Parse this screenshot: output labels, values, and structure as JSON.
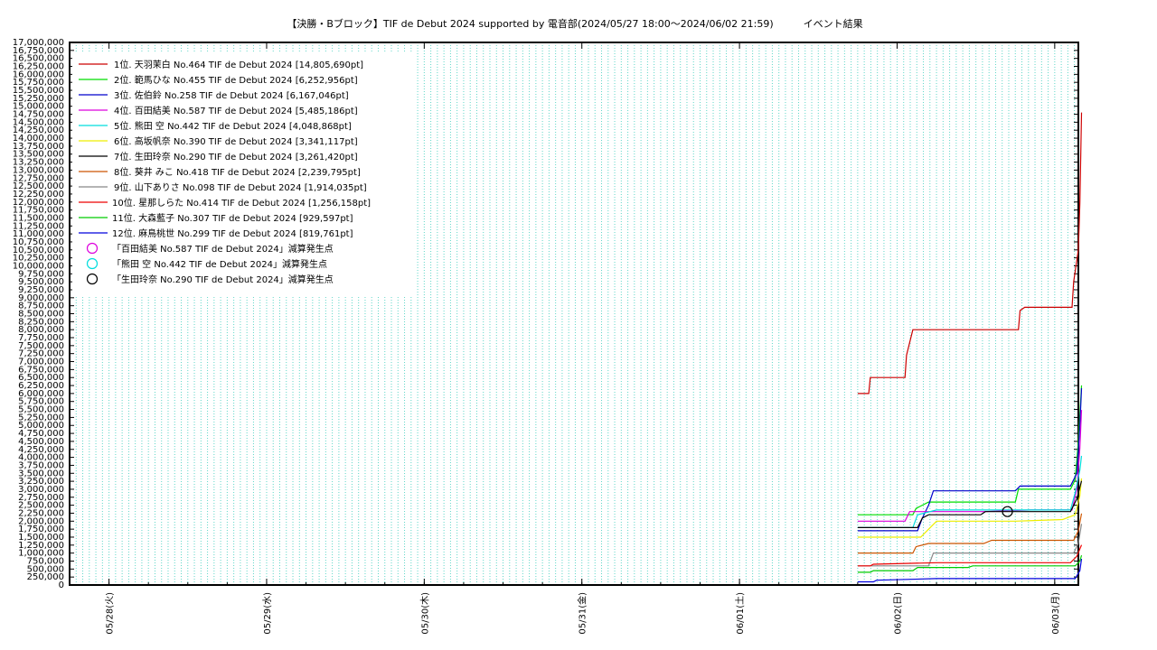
{
  "chart_data": {
    "type": "line",
    "title": "【決勝・Bブロック】TIF de Debut 2024 supported by 電音部(2024/05/27 18:00～2024/06/02 21:59)　　　イベント結果",
    "ylim": [
      0,
      17000000
    ],
    "xlim": [
      0,
      6.4
    ],
    "x_ticks": [
      {
        "x": 0.25,
        "label": "05/28(火)"
      },
      {
        "x": 1.25,
        "label": "05/29(水)"
      },
      {
        "x": 2.25,
        "label": "05/30(木)"
      },
      {
        "x": 3.25,
        "label": "05/31(金)"
      },
      {
        "x": 4.25,
        "label": "06/01(土)"
      },
      {
        "x": 5.25,
        "label": "06/02(日)"
      },
      {
        "x": 6.25,
        "label": "06/03(月)"
      }
    ],
    "y_tick_step": 250000,
    "grid": true,
    "legend_position": "top-left",
    "series": [
      {
        "name": "1位. 天羽茉白 No.464 TIF de Debut 2024 [14,805,690pt]",
        "color": "#cc0000",
        "points": [
          [
            5.0,
            6000000
          ],
          [
            5.07,
            6000000
          ],
          [
            5.08,
            6500000
          ],
          [
            5.3,
            6500000
          ],
          [
            5.31,
            7200000
          ],
          [
            5.33,
            7600000
          ],
          [
            5.35,
            8000000
          ],
          [
            6.02,
            8000000
          ],
          [
            6.03,
            8600000
          ],
          [
            6.06,
            8700000
          ],
          [
            6.36,
            8700000
          ],
          [
            6.37,
            9500000
          ],
          [
            6.4,
            10500000
          ],
          [
            6.41,
            12000000
          ],
          [
            6.42,
            14805690
          ]
        ]
      },
      {
        "name": "2位. 範馬ひな No.455 TIF de Debut 2024 [6,252,956pt]",
        "color": "#00dd00",
        "points": [
          [
            5.0,
            2200000
          ],
          [
            5.35,
            2200000
          ],
          [
            5.37,
            2400000
          ],
          [
            5.45,
            2600000
          ],
          [
            6.0,
            2600000
          ],
          [
            6.02,
            3000000
          ],
          [
            6.35,
            3000000
          ],
          [
            6.38,
            3300000
          ],
          [
            6.4,
            4500000
          ],
          [
            6.42,
            6252956
          ]
        ]
      },
      {
        "name": "3位. 佐伯鈴 No.258 TIF de Debut 2024 [6,167,046pt]",
        "color": "#0000cc",
        "points": [
          [
            5.0,
            1700000
          ],
          [
            5.38,
            1700000
          ],
          [
            5.41,
            2100000
          ],
          [
            5.45,
            2500000
          ],
          [
            5.48,
            2950000
          ],
          [
            6.0,
            2950000
          ],
          [
            6.03,
            3100000
          ],
          [
            6.35,
            3100000
          ],
          [
            6.39,
            3500000
          ],
          [
            6.41,
            5000000
          ],
          [
            6.42,
            6167046
          ]
        ]
      },
      {
        "name": "4位. 百田結美 No.587 TIF de Debut 2024 [5,485,186pt]",
        "color": "#dd00dd",
        "points": [
          [
            5.0,
            2000000
          ],
          [
            5.3,
            2000000
          ],
          [
            5.33,
            2300000
          ],
          [
            5.52,
            2300000
          ],
          [
            5.8,
            2300000
          ],
          [
            6.1,
            2350000
          ],
          [
            6.36,
            2350000
          ],
          [
            6.39,
            3000000
          ],
          [
            6.41,
            4300000
          ],
          [
            6.42,
            5485186
          ]
        ]
      },
      {
        "name": "5位. 熊田 空 No.442 TIF de Debut 2024 [4,048,868pt]",
        "color": "#00dddd",
        "points": [
          [
            5.0,
            1800000
          ],
          [
            5.35,
            1800000
          ],
          [
            5.38,
            2200000
          ],
          [
            5.5,
            2350000
          ],
          [
            6.35,
            2350000
          ],
          [
            6.38,
            2900000
          ],
          [
            6.41,
            3600000
          ],
          [
            6.42,
            4048868
          ]
        ]
      },
      {
        "name": "6位. 高坂帆奈 No.390 TIF de Debut 2024 [3,341,117pt]",
        "color": "#eeee00",
        "points": [
          [
            5.0,
            1500000
          ],
          [
            5.4,
            1500000
          ],
          [
            5.44,
            1700000
          ],
          [
            5.5,
            2000000
          ],
          [
            6.0,
            2000000
          ],
          [
            6.3,
            2050000
          ],
          [
            6.38,
            2200000
          ],
          [
            6.41,
            2800000
          ],
          [
            6.42,
            3341117
          ]
        ]
      },
      {
        "name": "7位. 生田玲奈 No.290 TIF de Debut 2024 [3,261,420pt]",
        "color": "#000000",
        "points": [
          [
            5.0,
            1800000
          ],
          [
            5.38,
            1800000
          ],
          [
            5.41,
            2100000
          ],
          [
            5.45,
            2200000
          ],
          [
            5.78,
            2200000
          ],
          [
            5.81,
            2300000
          ],
          [
            6.35,
            2300000
          ],
          [
            6.39,
            2700000
          ],
          [
            6.42,
            3261420
          ]
        ]
      },
      {
        "name": "8位. 葵井 みこ No.418 TIF de Debut 2024 [2,239,795pt]",
        "color": "#cc5500",
        "points": [
          [
            5.0,
            1000000
          ],
          [
            5.35,
            1000000
          ],
          [
            5.37,
            1200000
          ],
          [
            5.45,
            1300000
          ],
          [
            5.8,
            1300000
          ],
          [
            5.85,
            1400000
          ],
          [
            6.37,
            1400000
          ],
          [
            6.4,
            1700000
          ],
          [
            6.42,
            2239795
          ]
        ]
      },
      {
        "name": "9位. 山下ありさ No.098 TIF de Debut 2024 [1,914,035pt]",
        "color": "#888888",
        "points": [
          [
            5.0,
            600000
          ],
          [
            5.45,
            600000
          ],
          [
            5.48,
            1000000
          ],
          [
            6.37,
            1000000
          ],
          [
            6.4,
            1300000
          ],
          [
            6.42,
            1914035
          ]
        ]
      },
      {
        "name": "10位. 星那しらた No.414 TIF de Debut 2024 [1,256,158pt]",
        "color": "#ee0000",
        "points": [
          [
            5.0,
            600000
          ],
          [
            5.08,
            600000
          ],
          [
            5.1,
            650000
          ],
          [
            5.5,
            700000
          ],
          [
            6.35,
            700000
          ],
          [
            6.39,
            900000
          ],
          [
            6.42,
            1256158
          ]
        ]
      },
      {
        "name": "11位. 大森藍子 No.307 TIF de Debut 2024 [929,597pt]",
        "color": "#00cc00",
        "points": [
          [
            5.0,
            400000
          ],
          [
            5.08,
            400000
          ],
          [
            5.1,
            450000
          ],
          [
            5.35,
            450000
          ],
          [
            5.38,
            550000
          ],
          [
            5.7,
            550000
          ],
          [
            5.73,
            600000
          ],
          [
            6.38,
            600000
          ],
          [
            6.41,
            750000
          ],
          [
            6.42,
            929597
          ]
        ]
      },
      {
        "name": "12位. 麻鳥桃世 No.299 TIF de Debut 2024 [819,761pt]",
        "color": "#0000dd",
        "points": [
          [
            5.0,
            100000
          ],
          [
            5.1,
            100000
          ],
          [
            5.12,
            150000
          ],
          [
            5.5,
            200000
          ],
          [
            6.38,
            200000
          ],
          [
            6.41,
            450000
          ],
          [
            6.42,
            819761
          ]
        ]
      }
    ],
    "markers": [
      {
        "name": "「百田結美 No.587 TIF de Debut 2024」減算発生点",
        "color": "#dd00dd",
        "points": []
      },
      {
        "name": "「熊田 空 No.442 TIF de Debut 2024」減算発生点",
        "color": "#00dddd",
        "points": []
      },
      {
        "name": "「生田玲奈 No.290 TIF de Debut 2024」減算発生点",
        "color": "#000000",
        "points": [
          [
            5.95,
            2300000
          ]
        ]
      }
    ]
  }
}
